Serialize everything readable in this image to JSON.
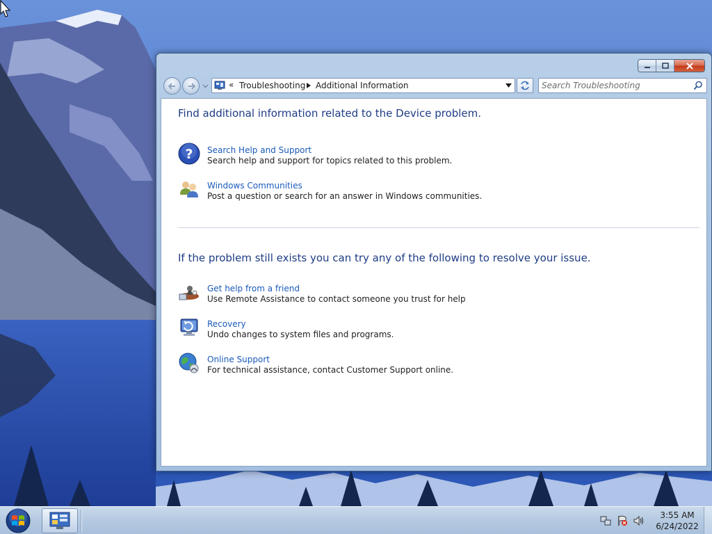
{
  "window": {
    "breadcrumb_overflow": "«",
    "breadcrumb": [
      "Troubleshooting",
      "Additional Information"
    ],
    "search_placeholder": "Search Troubleshooting"
  },
  "content": {
    "heading_1": "Find additional information related to the Device problem.",
    "heading_2": "If the problem still exists you can try any of the following to resolve your issue.",
    "items": [
      {
        "label": "Search Help and Support",
        "description": "Search help and support for topics related to this problem.",
        "icon": "help-icon"
      },
      {
        "label": "Windows Communities",
        "description": "Post a question or search for an answer in Windows communities.",
        "icon": "communities-icon"
      },
      {
        "label": "Get help from a friend",
        "description": "Use Remote Assistance to contact someone you trust for help",
        "icon": "remote-assistance-icon"
      },
      {
        "label": "Recovery",
        "description": "Undo changes to system files and programs.",
        "icon": "recovery-icon"
      },
      {
        "label": "Online Support",
        "description": "For technical assistance, contact Customer Support online.",
        "icon": "online-support-icon"
      }
    ]
  },
  "taskbar": {
    "time": "3:55 AM",
    "date": "6/24/2022",
    "tray_icons": [
      "network-icon",
      "action-center-icon",
      "volume-icon"
    ]
  },
  "colors": {
    "link": "#1a5ab8",
    "heading": "#1e3c84",
    "close_button": "#c1391a"
  }
}
